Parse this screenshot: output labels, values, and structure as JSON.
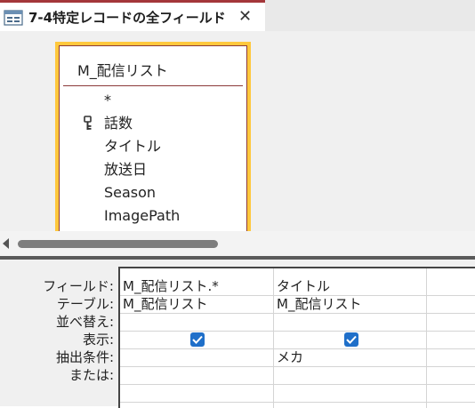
{
  "tab": {
    "title": "7-4特定レコードの全フィールド",
    "close": "✕"
  },
  "table": {
    "name": "M_配信リスト",
    "fields": [
      "*",
      "話数",
      "タイトル",
      "放送日",
      "Season",
      "ImagePath"
    ]
  },
  "grid": {
    "row_labels": [
      "フィールド:",
      "テーブル:",
      "並べ替え:",
      "表示:",
      "抽出条件:",
      "または:"
    ],
    "columns": [
      {
        "field": "M_配信リスト.*",
        "table": "M_配信リスト",
        "sort": "",
        "show": true,
        "criteria": "",
        "or": ""
      },
      {
        "field": "タイトル",
        "table": "M_配信リスト",
        "sort": "",
        "show": true,
        "criteria": "メカ",
        "or": ""
      }
    ]
  },
  "colors": {
    "tab_accent": "#a4373a",
    "table_highlight": "#ffc83d",
    "checkbox": "#1f6fc9"
  }
}
